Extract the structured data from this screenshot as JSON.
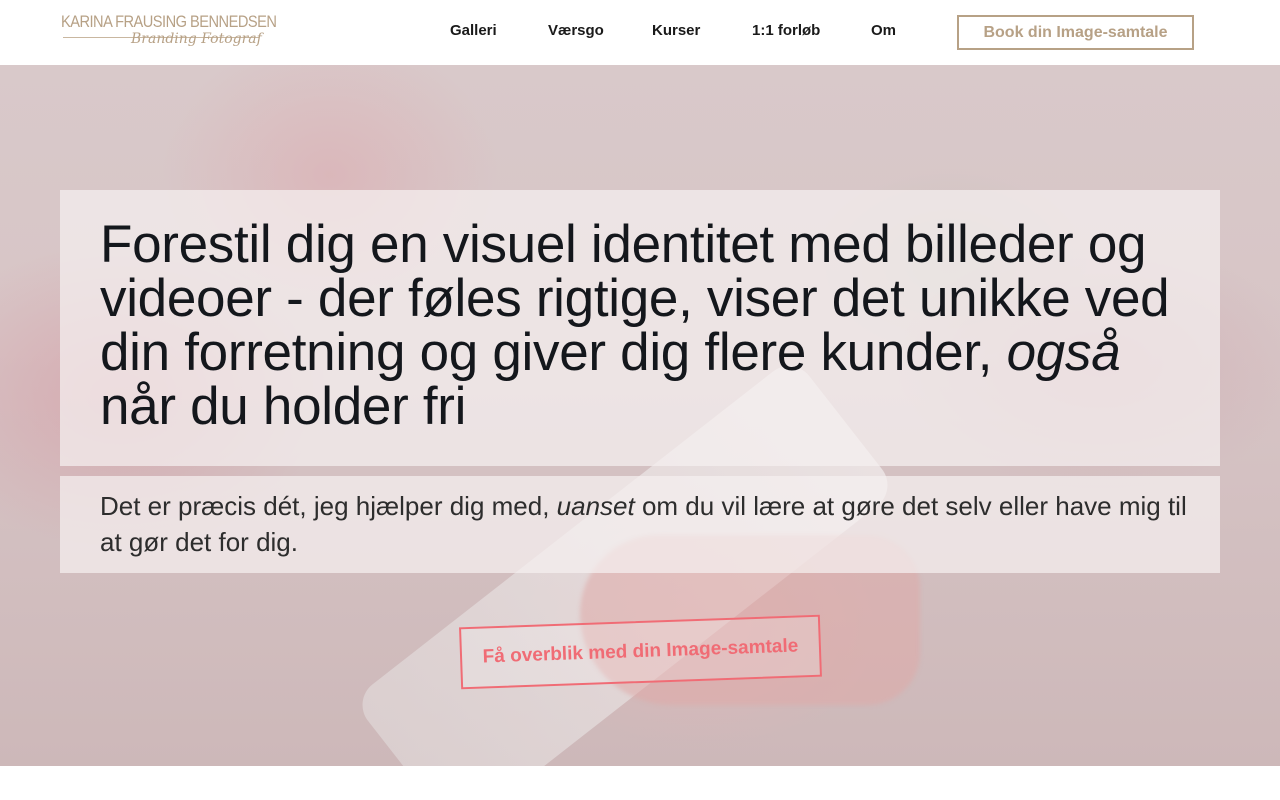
{
  "header": {
    "logo": {
      "name": "KARINA FRAUSING BENNEDSEN",
      "tagline": "Branding Fotograf"
    },
    "nav": [
      {
        "label": "Galleri"
      },
      {
        "label": "Værsgo"
      },
      {
        "label": "Kurser"
      },
      {
        "label": "1:1 forløb"
      },
      {
        "label": "Om"
      }
    ],
    "book_button": "Book din Image-samtale"
  },
  "hero": {
    "headline_part1": "Forestil dig en visuel identitet med billeder og videoer - der føles rigtige, viser det unikke ved din forretning og giver dig flere kunder, ",
    "headline_emphasis": "også",
    "headline_part2": " når du holder fri",
    "subtext_part1": "Det er præcis dét, jeg hjælper dig med, ",
    "subtext_emphasis": "uanset",
    "subtext_part2": " om du vil lære at gøre det selv eller have mig til at gør det for dig.",
    "cta": "Få overblik med din Image-samtale"
  },
  "colors": {
    "brand_gold": "#b7a186",
    "cta_coral": "#f06c75",
    "text_dark": "#14171c"
  }
}
